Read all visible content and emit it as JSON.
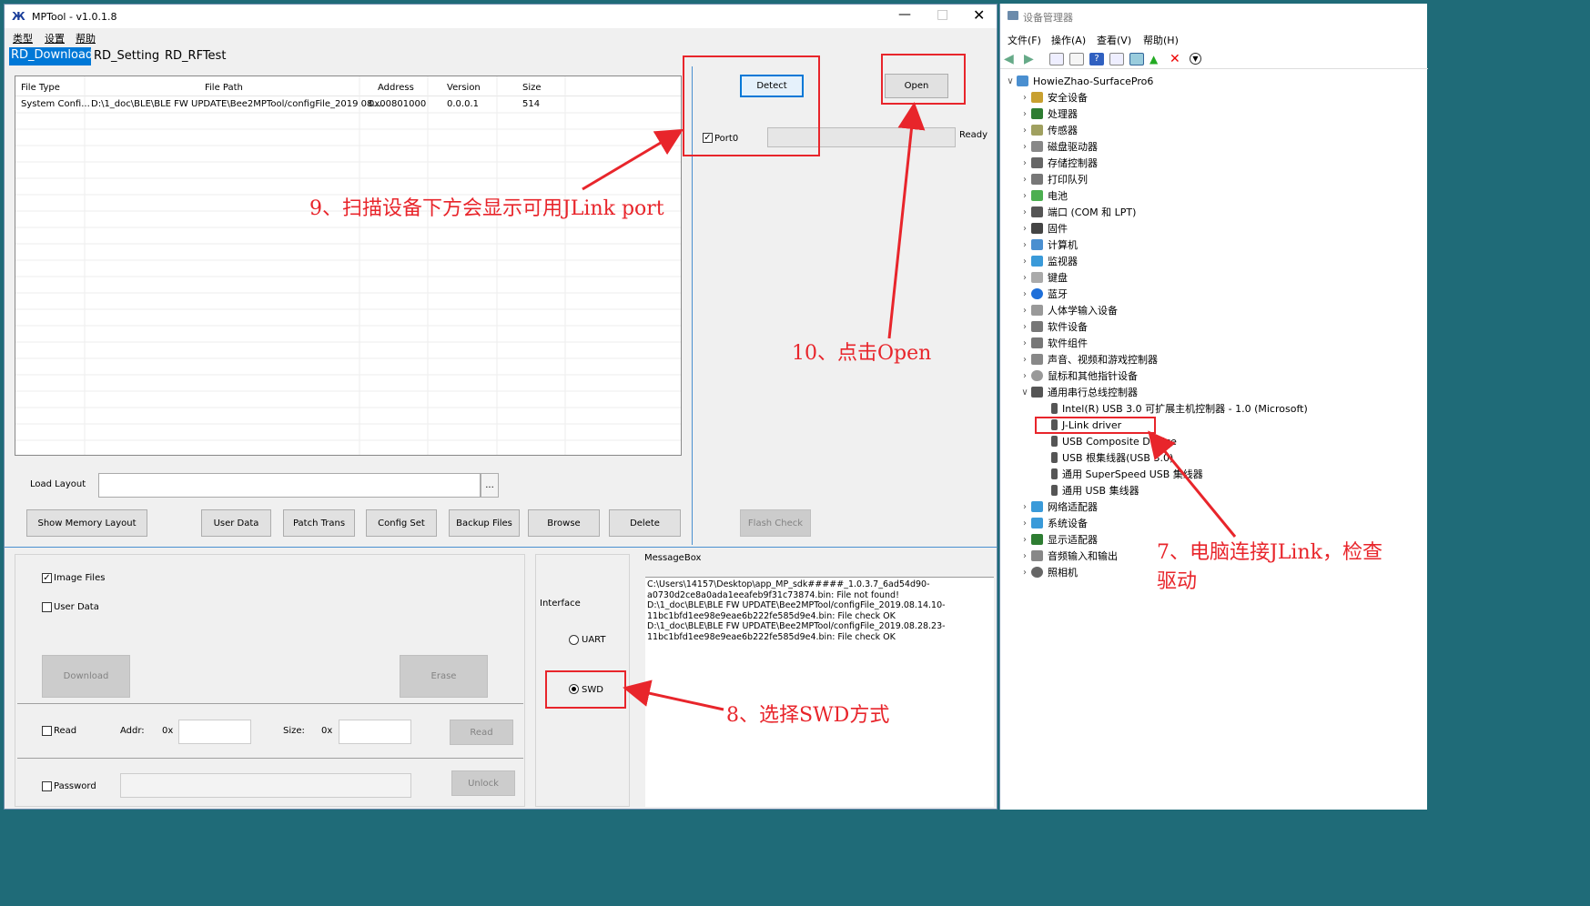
{
  "mptool": {
    "title": "MPTool - v1.0.1.8",
    "menu": [
      "类型",
      "设置",
      "帮助"
    ],
    "tabs": [
      "RD_Download",
      "RD_Setting",
      "RD_RFTest"
    ],
    "table": {
      "headers": [
        "File Type",
        "File Path",
        "Address",
        "Version",
        "Size"
      ],
      "rows": [
        [
          "System Confi...",
          "D:\\1_doc\\BLE\\BLE FW UPDATE\\Bee2MPTool/configFile_2019.08....",
          "0x00801000",
          "0.0.0.1",
          "514"
        ]
      ]
    },
    "load_layout": "Load Layout",
    "browse_dots": "...",
    "buttons": {
      "show_memory": "Show Memory Layout",
      "user_data": "User Data",
      "patch_trans": "Patch Trans",
      "config_set": "Config Set",
      "backup_files": "Backup Files",
      "browse": "Browse",
      "delete": "Delete",
      "detect": "Detect",
      "open": "Open",
      "flash_check": "Flash Check",
      "download": "Download",
      "erase": "Erase",
      "read": "Read",
      "unlock": "Unlock"
    },
    "port0": "Port0",
    "ready": "Ready",
    "image_files": "Image Files",
    "user_data_chk": "User Data",
    "read_chk": "Read",
    "addr_label": "Addr:",
    "hex_prefix": "0x",
    "size_label": "Size:",
    "password": "Password",
    "interface": "Interface",
    "uart": "UART",
    "swd": "SWD",
    "messagebox_title": "MessageBox",
    "messages": [
      "C:\\Users\\14157\\Desktop\\app_MP_sdk#####_1.0.3.7_6ad54d90-",
      "a0730d2ce8a0ada1eeafeb9f31c73874.bin: File not found!",
      "D:\\1_doc\\BLE\\BLE FW UPDATE\\Bee2MPTool/configFile_2019.08.14.10-",
      "11bc1bfd1ee98e9eae6b222fe585d9e4.bin: File check OK",
      "D:\\1_doc\\BLE\\BLE FW UPDATE\\Bee2MPTool/configFile_2019.08.28.23-",
      "11bc1bfd1ee98e9eae6b222fe585d9e4.bin: File check OK"
    ]
  },
  "devmgr": {
    "title": "设备管理器",
    "menu": [
      "文件(F)",
      "操作(A)",
      "查看(V)",
      "帮助(H)"
    ],
    "root": "HowieZhao-SurfacePro6",
    "items": [
      "安全设备",
      "处理器",
      "传感器",
      "磁盘驱动器",
      "存储控制器",
      "打印队列",
      "电池",
      "端口 (COM 和 LPT)",
      "固件",
      "计算机",
      "监视器",
      "键盘",
      "蓝牙",
      "人体学输入设备",
      "软件设备",
      "软件组件",
      "声音、视频和游戏控制器",
      "鼠标和其他指针设备",
      "通用串行总线控制器"
    ],
    "usb_children": [
      "Intel(R) USB 3.0 可扩展主机控制器 - 1.0 (Microsoft)",
      "J-Link driver",
      "USB Composite Device",
      "USB 根集线器(USB 3.0)",
      "通用 SuperSpeed USB 集线器",
      "通用 USB 集线器"
    ],
    "items_after": [
      "网络适配器",
      "系统设备",
      "显示适配器",
      "音频输入和输出",
      "照相机"
    ]
  },
  "annotations": {
    "step9": "9、扫描设备下方会显示可用JLink port",
    "step10": "10、点击Open",
    "step8": "8、选择SWD方式",
    "step7_line1": "7、电脑连接JLink，检查",
    "step7_line2": "驱动"
  },
  "colors": {
    "annotation_red": "#e8252b",
    "tab_selected": "#0078d7",
    "desktop": "#1f6b78"
  }
}
